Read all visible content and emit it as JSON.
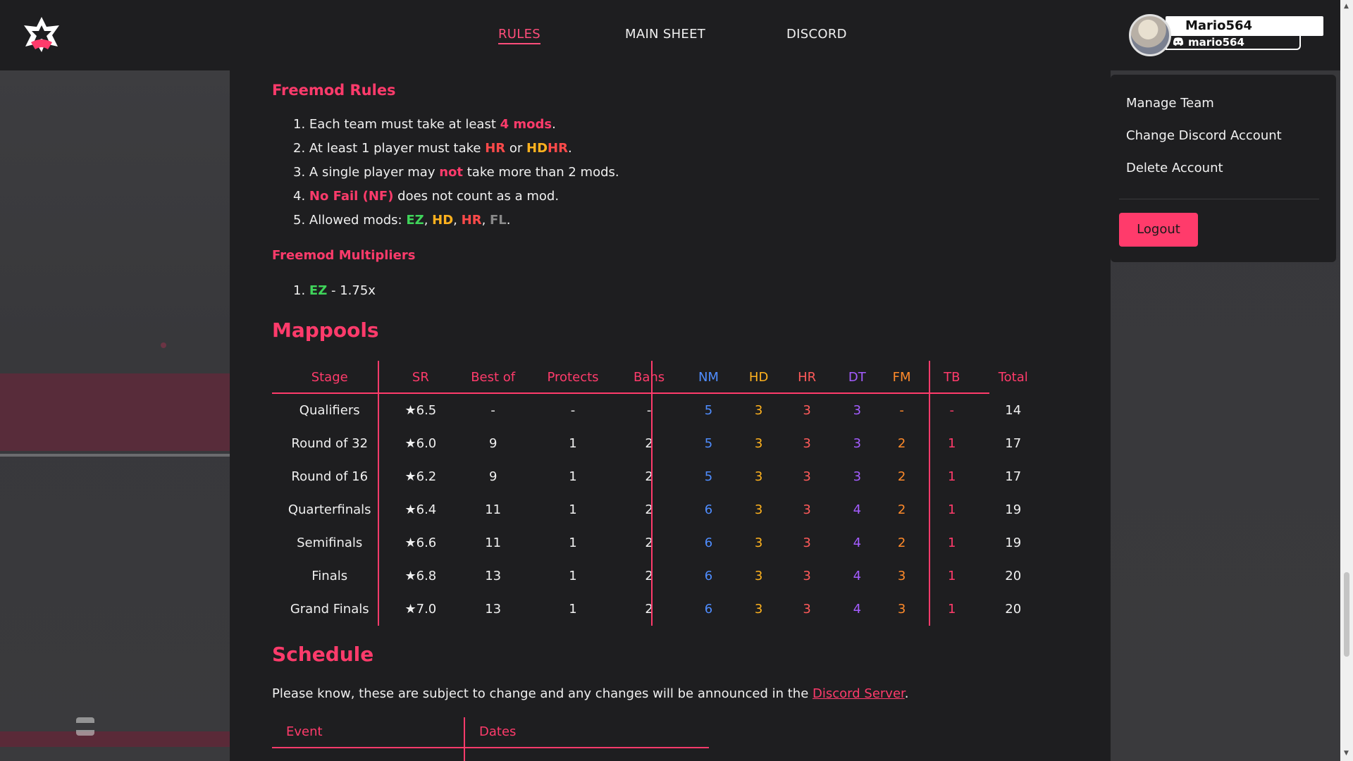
{
  "nav": {
    "rules": "RULES",
    "main_sheet": "MAIN SHEET",
    "discord": "DISCORD"
  },
  "user": {
    "name": "Mario564",
    "discord": "mario564"
  },
  "dropdown": {
    "manage_team": "Manage Team",
    "change_discord": "Change Discord Account",
    "delete_account": "Delete Account",
    "logout": "Logout"
  },
  "freemod": {
    "title": "Freemod Rules",
    "rules": [
      {
        "num": "1.",
        "pre": "Each team must take at least ",
        "hl": "4 mods",
        "post": "."
      },
      {
        "num": "2.",
        "pre": "At least 1 player must take ",
        "hl": "HR",
        "mid": " or ",
        "hl2a": "HD",
        "hl2b": "HR",
        "post": "."
      },
      {
        "num": "3.",
        "pre": "A single player may ",
        "hl": "not",
        "post": " take more than 2 mods."
      },
      {
        "num": "4.",
        "pre": "",
        "hl": "No Fail (NF)",
        "post": " does not count as a mod."
      },
      {
        "num": "5.",
        "pre": "Allowed mods: ",
        "m1": "EZ",
        "m2": "HD",
        "m3": "HR",
        "m4": "FL",
        "post": "."
      }
    ],
    "multipliers_title": "Freemod Multipliers",
    "multipliers": [
      {
        "num": "1.",
        "mod": "EZ",
        "value": " - 1.75x"
      }
    ]
  },
  "mappools": {
    "title": "Mappools",
    "headers": [
      "Stage",
      "SR",
      "Best of",
      "Protects",
      "Bans",
      "NM",
      "HD",
      "HR",
      "DT",
      "FM",
      "TB",
      "Total"
    ],
    "rows": [
      [
        "Qualifiers",
        "★6.5",
        "-",
        "-",
        "-",
        "5",
        "3",
        "3",
        "3",
        "-",
        "-",
        "14"
      ],
      [
        "Round of 32",
        "★6.0",
        "9",
        "1",
        "2",
        "5",
        "3",
        "3",
        "3",
        "2",
        "1",
        "17"
      ],
      [
        "Round of 16",
        "★6.2",
        "9",
        "1",
        "2",
        "5",
        "3",
        "3",
        "3",
        "2",
        "1",
        "17"
      ],
      [
        "Quarterfinals",
        "★6.4",
        "11",
        "1",
        "2",
        "6",
        "3",
        "3",
        "4",
        "2",
        "1",
        "19"
      ],
      [
        "Semifinals",
        "★6.6",
        "11",
        "1",
        "2",
        "6",
        "3",
        "3",
        "4",
        "2",
        "1",
        "19"
      ],
      [
        "Finals",
        "★6.8",
        "13",
        "1",
        "2",
        "6",
        "3",
        "3",
        "4",
        "3",
        "1",
        "20"
      ],
      [
        "Grand Finals",
        "★7.0",
        "13",
        "1",
        "2",
        "6",
        "3",
        "3",
        "4",
        "3",
        "1",
        "20"
      ]
    ]
  },
  "schedule": {
    "title": "Schedule",
    "text": "Please know, these are subject to change and any changes will be announced in the ",
    "link": "Discord Server",
    "text_end": ".",
    "headers": [
      "Event",
      "Dates"
    ]
  }
}
